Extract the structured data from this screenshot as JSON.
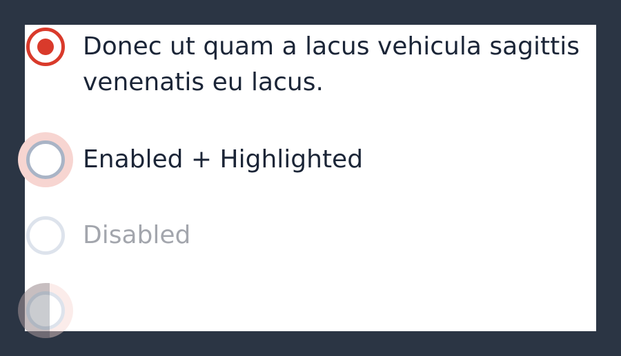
{
  "options": [
    {
      "label": "Donec ut quam a lacus vehicula sagittis venenatis eu lacus.",
      "state": "checked"
    },
    {
      "label": "Enabled + Highlighted",
      "state": "highlighted"
    },
    {
      "label": "Disabled",
      "state": "disabled"
    },
    {
      "label": "",
      "state": "focused-empty"
    }
  ],
  "colors": {
    "accent": "#d93a2b",
    "background": "#2b3544",
    "panel": "#ffffff",
    "text": "#1b2537",
    "disabled_text": "#a3a6ad",
    "radio_border": "#a9b4c6",
    "halo": "#f7d5d1"
  }
}
